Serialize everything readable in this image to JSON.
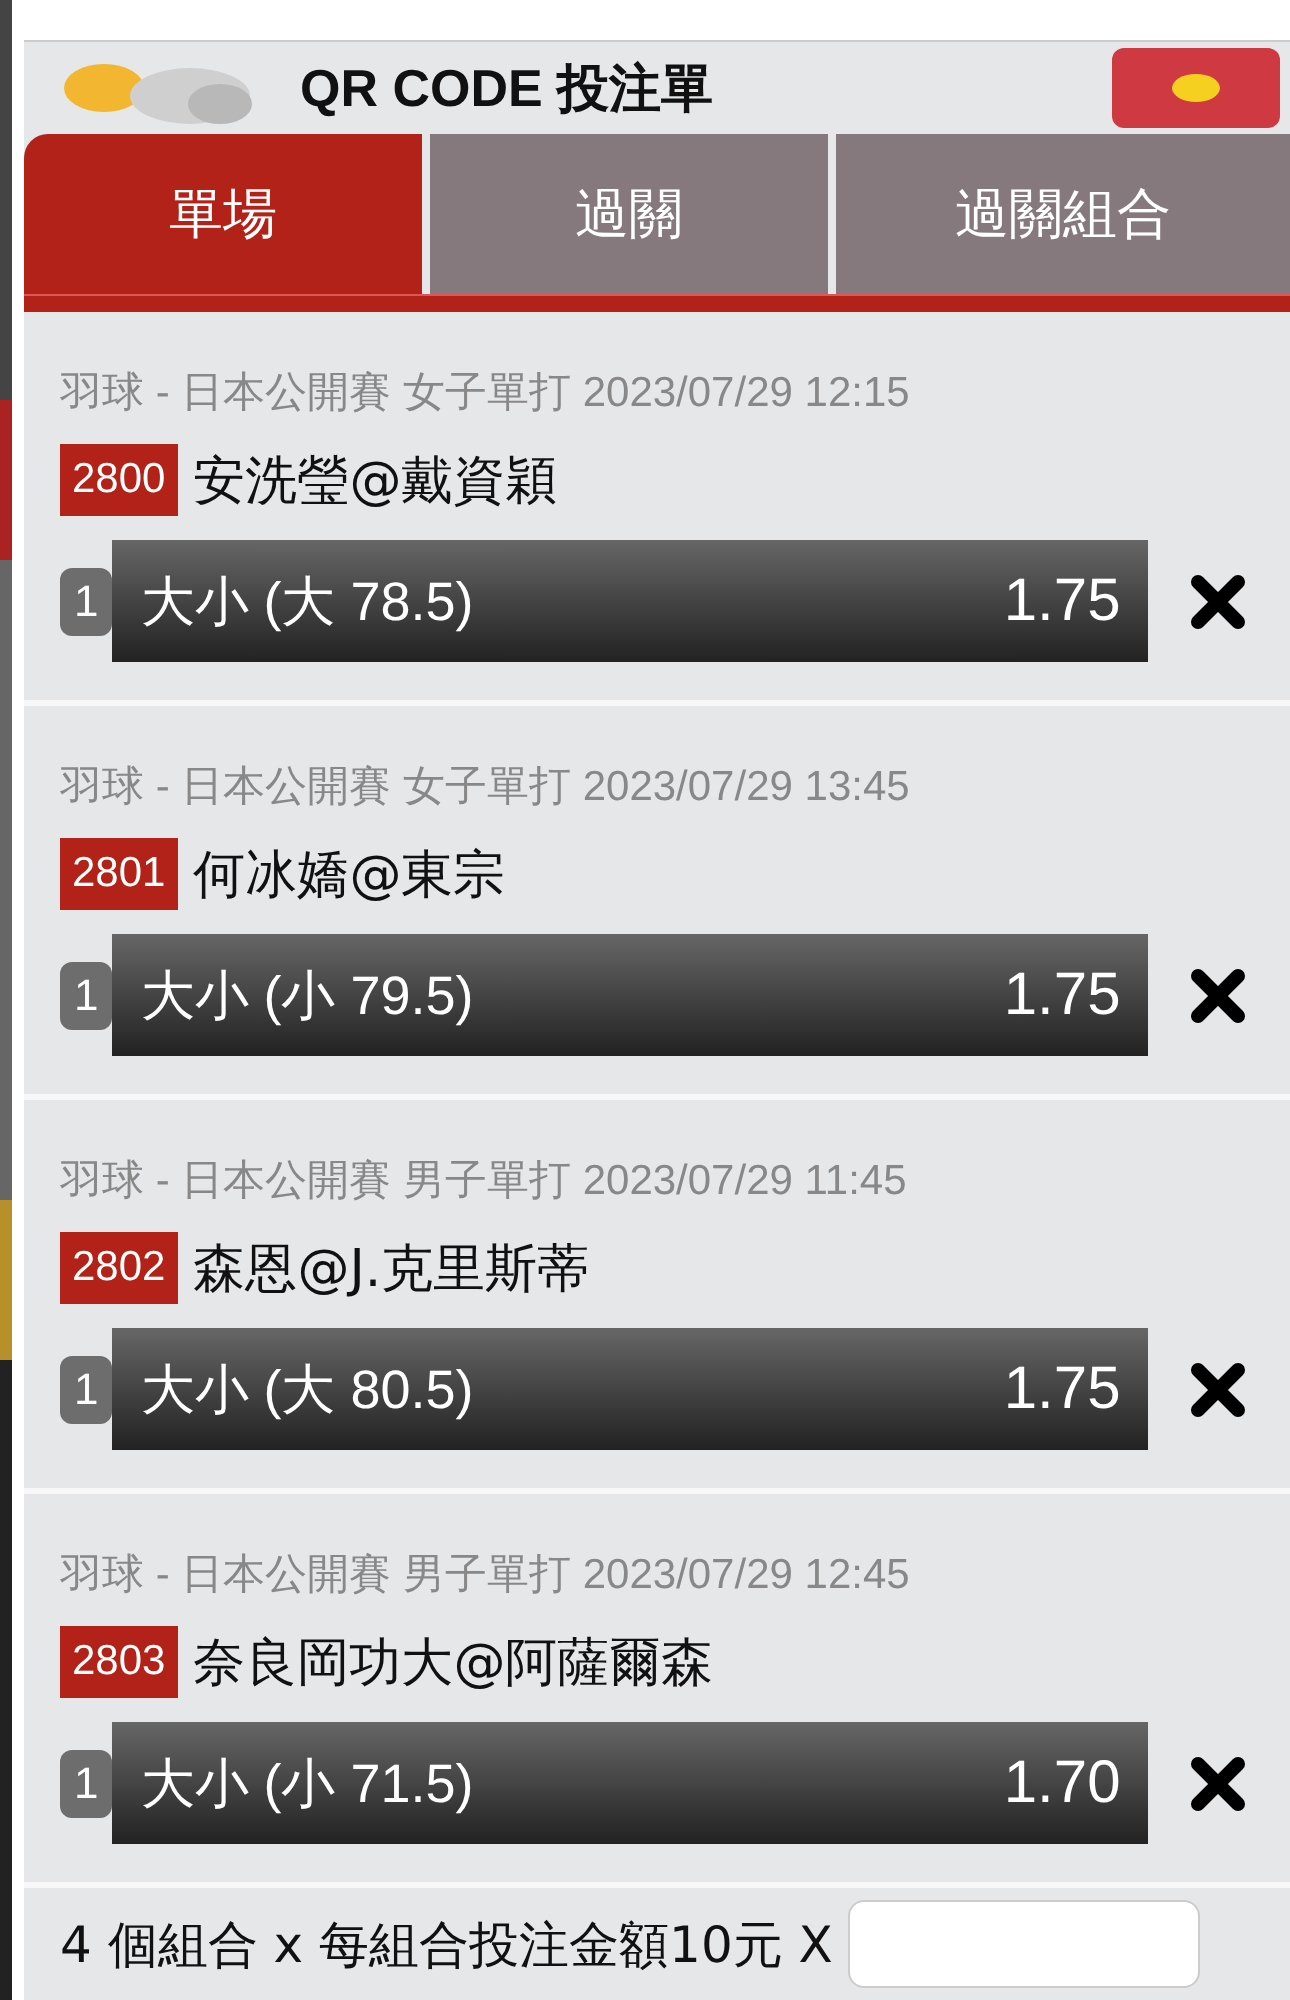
{
  "header": {
    "title": "QR CODE 投注單"
  },
  "tabs": [
    {
      "label": "單場",
      "selected": true
    },
    {
      "label": "過關",
      "selected": false
    },
    {
      "label": "過關組合",
      "selected": false
    }
  ],
  "bets": [
    {
      "event": "羽球 - 日本公開賽 女子單打 2023/07/29 12:15",
      "code": "2800",
      "match": "安洗瑩@戴資穎",
      "index": "1",
      "selection": "大小 (大 78.5)",
      "odds": "1.75"
    },
    {
      "event": "羽球 - 日本公開賽 女子單打 2023/07/29 13:45",
      "code": "2801",
      "match": "何冰嬌@東宗",
      "index": "1",
      "selection": "大小 (小 79.5)",
      "odds": "1.75"
    },
    {
      "event": "羽球 - 日本公開賽 男子單打 2023/07/29 11:45",
      "code": "2802",
      "match": "森恩@J.克里斯蒂",
      "index": "1",
      "selection": "大小 (大 80.5)",
      "odds": "1.75"
    },
    {
      "event": "羽球 - 日本公開賽 男子單打 2023/07/29 12:45",
      "code": "2803",
      "match": "奈良岡功大@阿薩爾森",
      "index": "1",
      "selection": "大小 (小 71.5)",
      "odds": "1.70"
    }
  ],
  "footer": {
    "summary": "4 個組合 x 每組合投注金額10元 X"
  }
}
